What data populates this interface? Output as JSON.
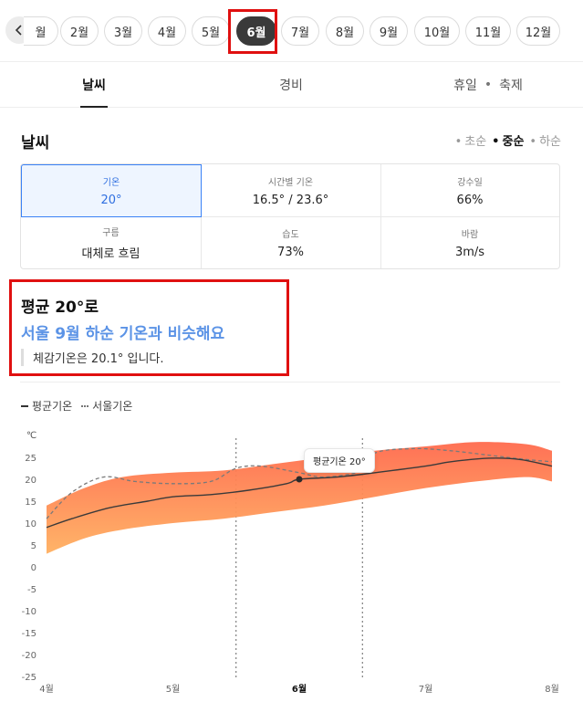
{
  "months": [
    "월",
    "2월",
    "3월",
    "4월",
    "5월",
    "6월",
    "7월",
    "8월",
    "9월",
    "10월",
    "11월",
    "12월"
  ],
  "active_month": "6월",
  "tabs": {
    "weather": "날씨",
    "cost": "경비",
    "holiday": "휴일",
    "dot": "•",
    "festival": "축제"
  },
  "section": {
    "title": "날씨",
    "periods": {
      "early": "초순",
      "mid": "중순",
      "late": "하순",
      "bullet": "•"
    }
  },
  "stats": {
    "temp": {
      "label": "기온",
      "value": "20°"
    },
    "hourly": {
      "label": "시간별 기온",
      "value": "16.5° / 23.6°"
    },
    "rain": {
      "label": "강수일",
      "value": "66%"
    },
    "cloud": {
      "label": "구름",
      "value": "대체로 흐림"
    },
    "humidity": {
      "label": "습도",
      "value": "73%"
    },
    "wind": {
      "label": "바람",
      "value": "3m/s"
    }
  },
  "summary": {
    "line1": "평균 20°로",
    "line2": "서울 9월 하순 기온과 비슷해요",
    "line3": "체감기온은 20.1° 입니다."
  },
  "legend": {
    "avg": "평균기온",
    "seoul": "서울기온"
  },
  "tooltip": "평균기온 20°",
  "colors": {
    "accent": "#3b82f6",
    "highlight": "#e01010",
    "band_top": "#ff6a4d",
    "band_bottom": "#ffb060"
  },
  "chart_data": {
    "type": "area",
    "unit_label": "℃",
    "ylim": [
      -25,
      28
    ],
    "y_ticks": [
      25,
      20,
      15,
      10,
      5,
      0,
      -5,
      -10,
      -15,
      -20,
      -25
    ],
    "x_ticks": [
      "4월",
      "5월",
      "6월",
      "7월",
      "8월"
    ],
    "x_tick_positions": [
      1,
      2,
      3,
      4,
      5
    ],
    "xlim": [
      1,
      5
    ],
    "highlight_x": "6월",
    "range_lines": [
      2.5,
      3.5
    ],
    "series": [
      {
        "name": "평균기온",
        "x": [
          1,
          1.2,
          1.5,
          1.8,
          2,
          2.3,
          2.6,
          2.9,
          3,
          3.3,
          3.6,
          4,
          4.2,
          4.5,
          4.75,
          5
        ],
        "values": [
          9,
          11,
          13.5,
          15,
          16,
          16.5,
          17.5,
          19,
          20,
          20.5,
          21.5,
          23,
          24,
          24.8,
          24.5,
          23
        ]
      },
      {
        "name": "서울기온",
        "x": [
          1,
          1.2,
          1.45,
          1.7,
          2,
          2.3,
          2.5,
          2.7,
          3,
          3.2,
          3.5,
          3.6,
          3.9,
          4.2,
          4.5,
          4.8,
          5
        ],
        "values": [
          11,
          17,
          20.5,
          19.5,
          19,
          19.5,
          22.5,
          23,
          21.5,
          20.5,
          22,
          26,
          27,
          26.5,
          25.5,
          24.5,
          24
        ]
      },
      {
        "name": "band_upper",
        "x": [
          1,
          1.3,
          1.6,
          2,
          2.4,
          2.8,
          3.2,
          3.6,
          4,
          4.4,
          4.8,
          5
        ],
        "values": [
          14,
          18,
          20.5,
          21.5,
          22,
          23.5,
          25,
          26.5,
          27.5,
          28.5,
          28,
          26.5
        ]
      },
      {
        "name": "band_lower",
        "x": [
          1,
          1.3,
          1.6,
          2,
          2.4,
          2.8,
          3.2,
          3.6,
          4,
          4.4,
          4.8,
          5
        ],
        "values": [
          3,
          6.5,
          8.5,
          10,
          11,
          12.5,
          14,
          16,
          18,
          19.5,
          20.5,
          19.5
        ]
      }
    ],
    "highlight_point": {
      "x": 3,
      "y": 20
    }
  }
}
